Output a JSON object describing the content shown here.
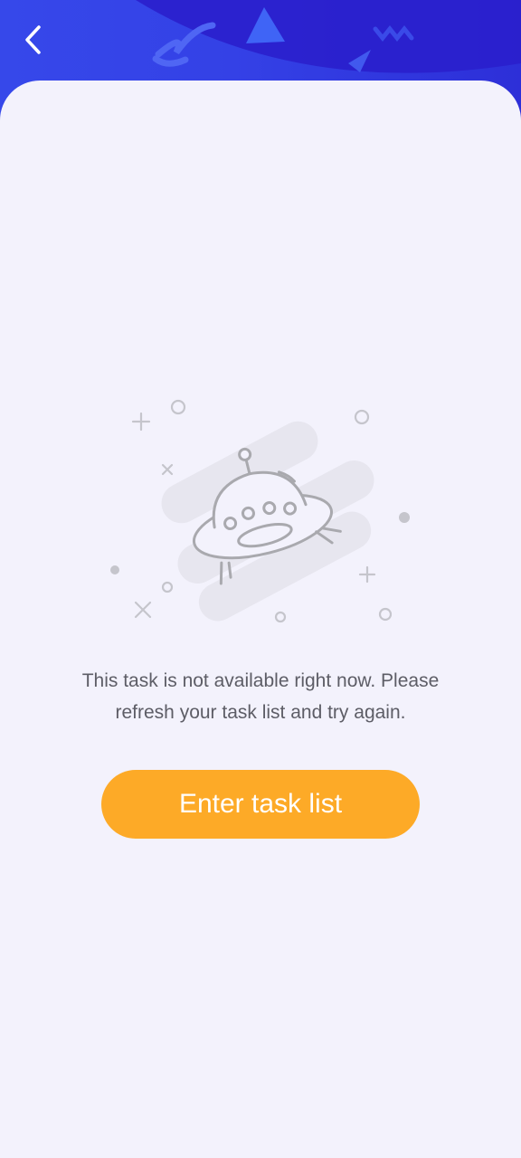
{
  "header": {
    "back_icon": "chevron-left-icon"
  },
  "empty_state": {
    "illustration": "ufo-icon",
    "message": "This task is not available right now. Please\nrefresh your task list and try again.",
    "button_label": "Enter task list"
  },
  "colors": {
    "header_blue": "#3441e6",
    "background": "#f3f2fc",
    "button": "#fdaa27",
    "text": "#5d5d66"
  }
}
